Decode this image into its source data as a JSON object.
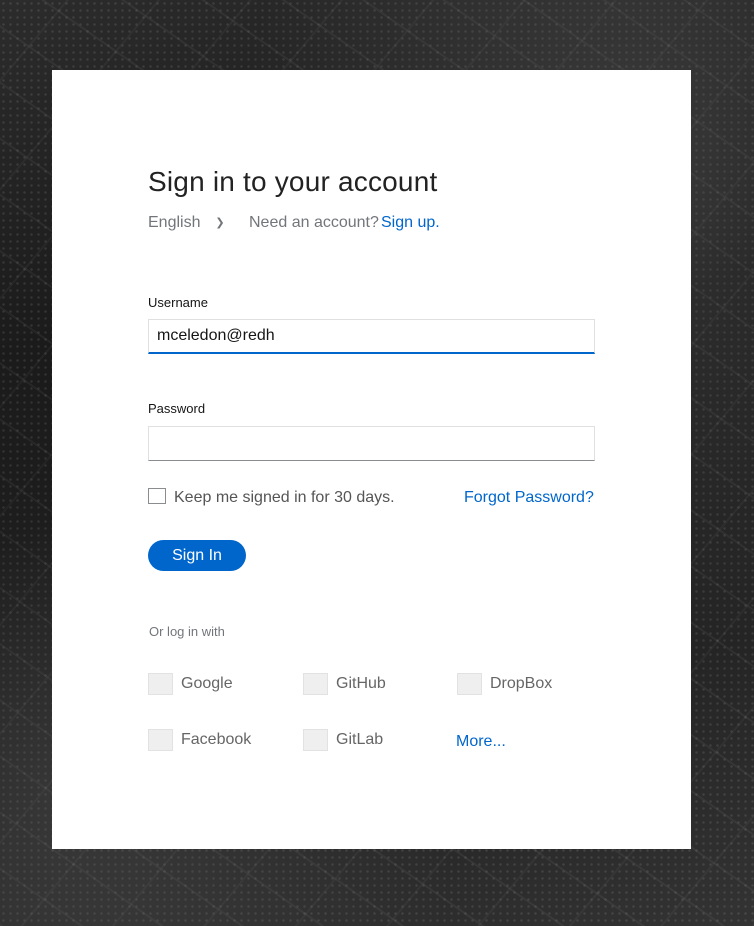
{
  "login": {
    "title": "Sign in to your account",
    "language": "English",
    "need_account": "Need an account?",
    "signup_link": "Sign up.",
    "username_label": "Username",
    "username_value": "mceledon@redh",
    "password_label": "Password",
    "password_value": "",
    "remember_label": "Keep me signed in for 30 days.",
    "remember_checked": false,
    "forgot_link": "Forgot Password?",
    "signin_button": "Sign In",
    "or_log_in_with": "Or log in with",
    "providers": [
      {
        "label": "Google",
        "icon": "google-icon"
      },
      {
        "label": "GitHub",
        "icon": "github-icon"
      },
      {
        "label": "DropBox",
        "icon": "dropbox-icon"
      },
      {
        "label": "Facebook",
        "icon": "facebook-icon"
      },
      {
        "label": "GitLab",
        "icon": "gitlab-icon"
      }
    ],
    "more_link": "More..."
  },
  "colors": {
    "accent": "#0066cc",
    "card": "#ffffff",
    "background": "#1f1f1f"
  }
}
